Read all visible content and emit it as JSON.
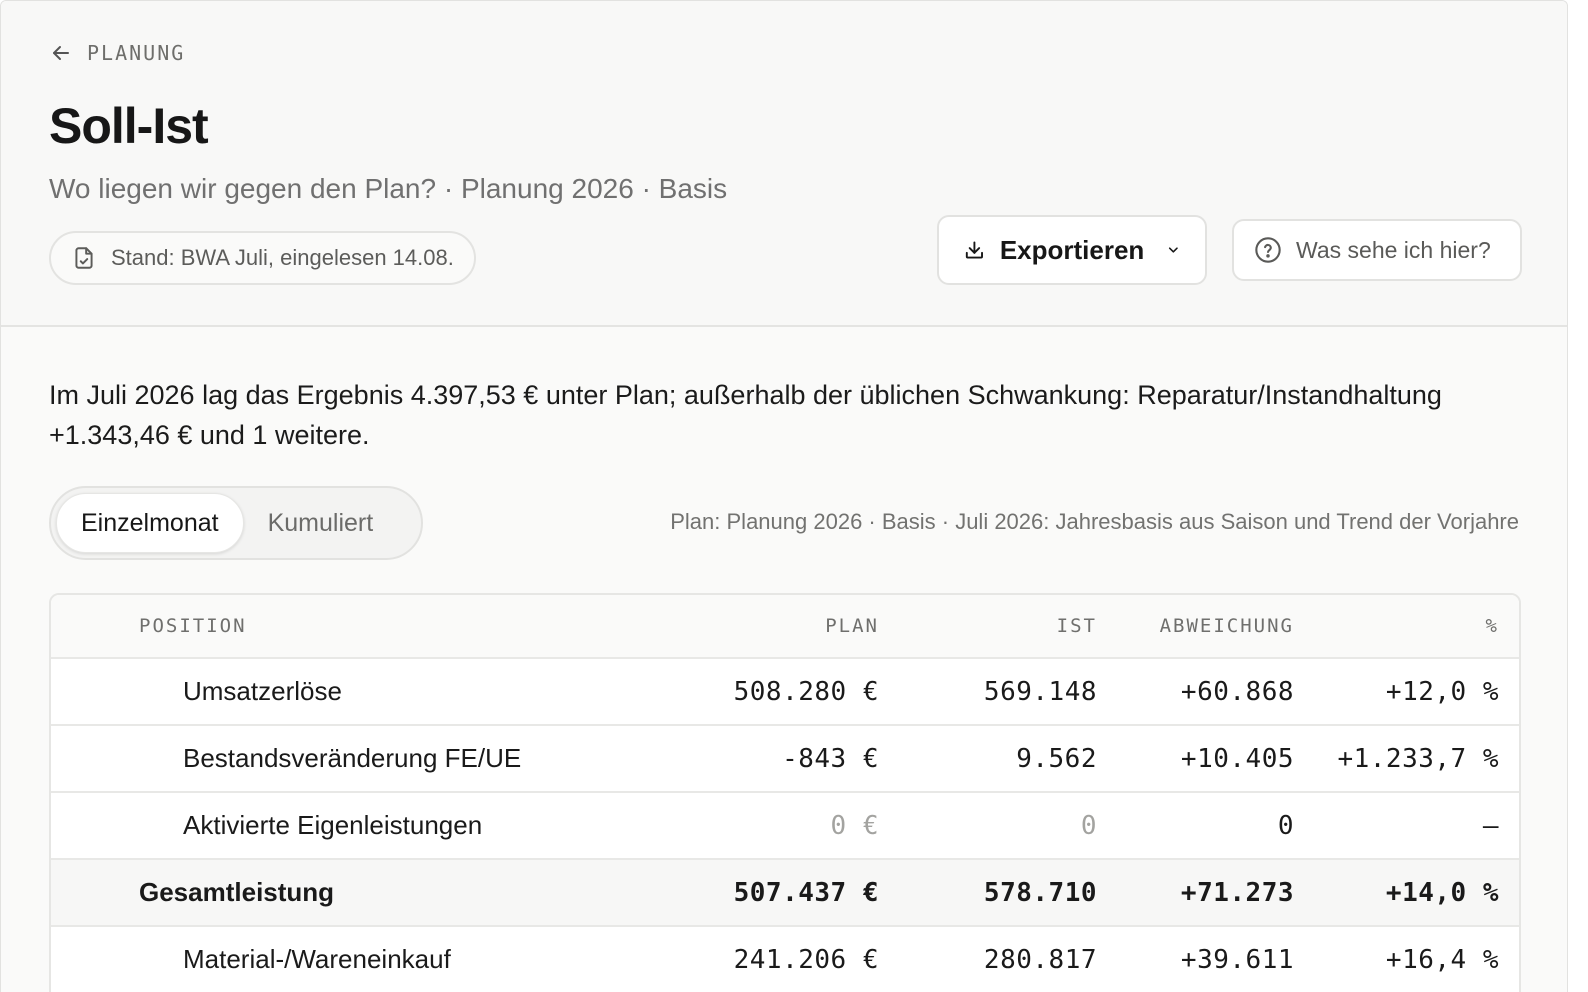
{
  "header": {
    "back_label": "PLANUNG",
    "title": "Soll-Ist",
    "subtitle": "Wo liegen wir gegen den Plan? · Planung 2026 · Basis",
    "stand_label": "Stand: BWA Juli, eingelesen 14.08.",
    "export_label": "Exportieren",
    "help_label": "Was sehe ich hier?"
  },
  "summary": "Im Juli 2026 lag das Ergebnis 4.397,53 € unter Plan; außerhalb der üblichen Schwankung: Reparatur/Instandhaltung +1.343,46 € und 1 weitere.",
  "toggle": {
    "active": "Einzelmonat",
    "inactive": "Kumuliert"
  },
  "plan_note": "Plan: Planung 2026 · Basis · Juli 2026: Jahresbasis aus Saison und Trend der Vorjahre",
  "table": {
    "columns": {
      "position": "POSITION",
      "plan": "PLAN",
      "ist": "IST",
      "abweichung": "ABWEICHUNG",
      "pct": "%"
    },
    "rows": [
      {
        "position": "Umsatzerlöse",
        "plan": "508.280 €",
        "ist": "569.148",
        "abweichung": "+60.868",
        "pct": "+12,0 %"
      },
      {
        "position": "Bestandsveränderung FE/UE",
        "plan": "-843 €",
        "ist": "9.562",
        "abweichung": "+10.405",
        "pct": "+1.233,7 %"
      },
      {
        "position": "Aktivierte Eigenleistungen",
        "plan": "0 €",
        "ist": "0",
        "abweichung": "0",
        "pct": "–"
      },
      {
        "position": "Gesamtleistung",
        "plan": "507.437 €",
        "ist": "578.710",
        "abweichung": "+71.273",
        "pct": "+14,0 %"
      },
      {
        "position": "Material-/Wareneinkauf",
        "plan": "241.206 €",
        "ist": "280.817",
        "abweichung": "+39.611",
        "pct": "+16,4 %"
      }
    ]
  }
}
